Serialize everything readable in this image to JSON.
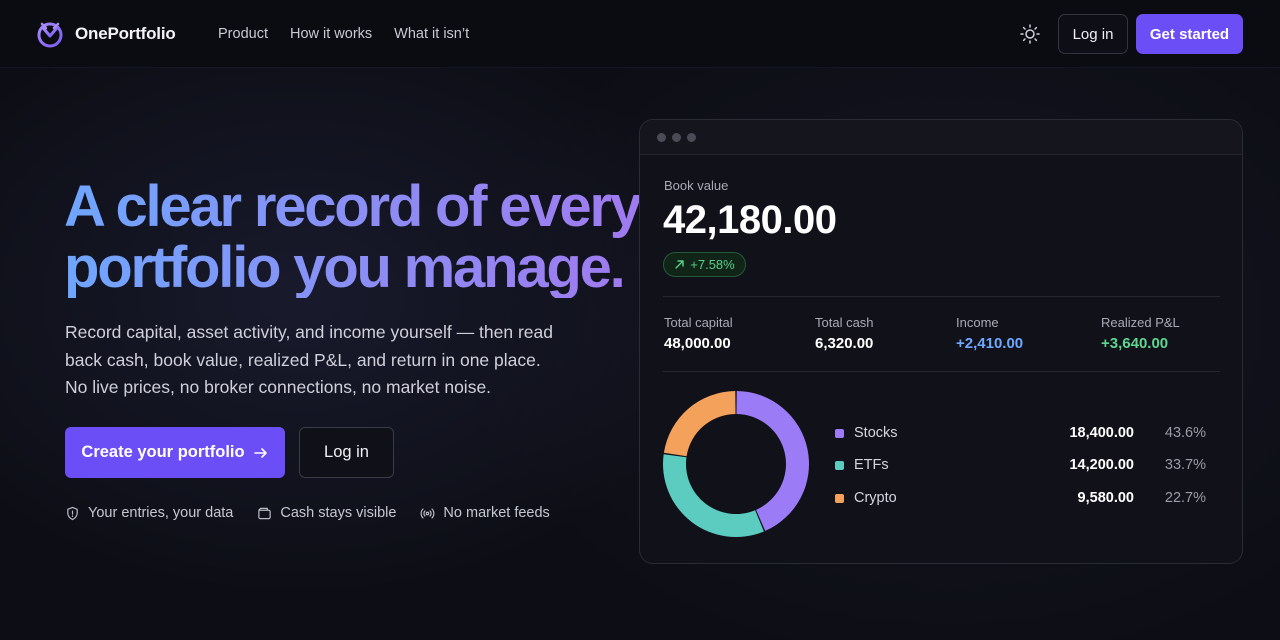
{
  "brand": {
    "name": "OnePortfolio"
  },
  "nav": {
    "links": [
      "Product",
      "How it works",
      "What it isn’t"
    ],
    "login": "Log in",
    "cta": "Get started"
  },
  "hero": {
    "title": "A clear record of every portfolio you manage.",
    "subtitle": "Record capital, asset activity, and income yourself — then read back cash, book value, realized P&L, and return in one place. No live prices, no broker connections, no market noise.",
    "primary_cta": "Create your portfolio",
    "secondary_cta": "Log in",
    "features": [
      {
        "icon": "shield-icon",
        "label": "Your entries, your data"
      },
      {
        "icon": "wallet-icon",
        "label": "Cash stays visible"
      },
      {
        "icon": "broadcast-icon",
        "label": "No market feeds"
      }
    ]
  },
  "card": {
    "book_value_label": "Book value",
    "book_value": "42,180.00",
    "change": "+7.58%",
    "stats": [
      {
        "label": "Total capital",
        "value": "48,000.00",
        "color": "#ffffff"
      },
      {
        "label": "Total cash",
        "value": "6,320.00",
        "color": "#ffffff"
      },
      {
        "label": "Income",
        "value": "+2,410.00",
        "color": "#6fa8ff"
      },
      {
        "label": "Realized P&L",
        "value": "+3,640.00",
        "color": "#5fd68f"
      }
    ],
    "allocation": [
      {
        "name": "Stocks",
        "value": "18,400.00",
        "pct": "43.6%",
        "share": 43.6,
        "color": "#9b7cf6"
      },
      {
        "name": "ETFs",
        "value": "14,200.00",
        "pct": "33.7%",
        "share": 33.7,
        "color": "#5cccc0"
      },
      {
        "name": "Crypto",
        "value": "9,580.00",
        "pct": "22.7%",
        "share": 22.7,
        "color": "#f4a15c"
      }
    ]
  },
  "colors": {
    "accent": "#6b4ef6",
    "positive": "#5fd68f",
    "income": "#6fa8ff"
  }
}
